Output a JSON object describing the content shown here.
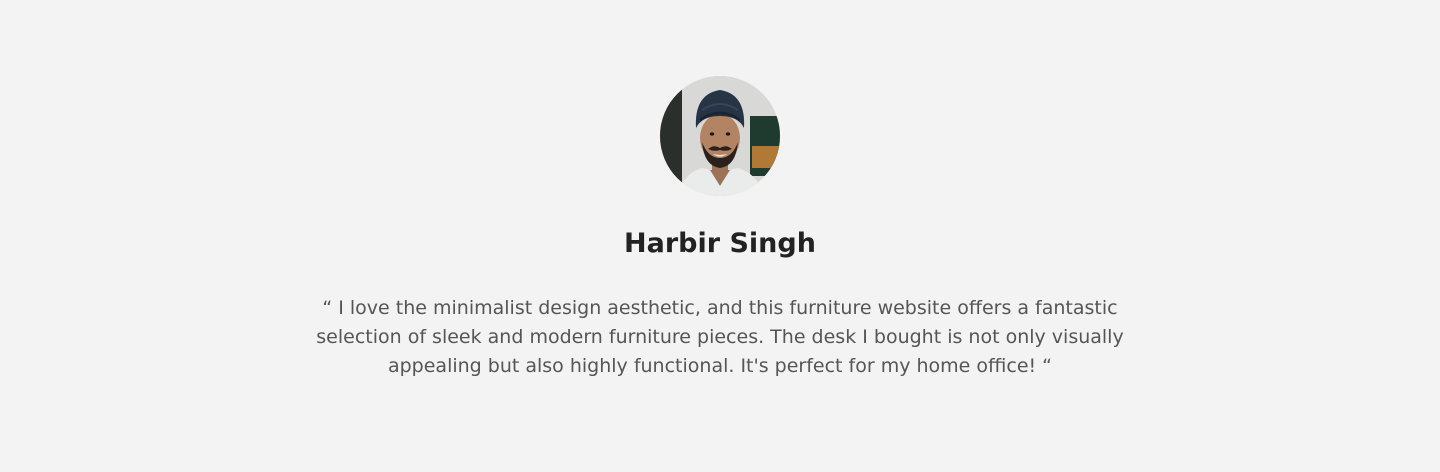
{
  "testimonial": {
    "name": "Harbir Singh",
    "quote": "“ I love the minimalist design aesthetic, and this furniture website offers a fantastic selection of sleek and modern furniture pieces. The desk I bought is not only visually appealing but also highly functional. It's perfect for my home office! “"
  },
  "colors": {
    "background": "#f3f3f3",
    "name_text": "#222222",
    "quote_text": "#555555"
  }
}
